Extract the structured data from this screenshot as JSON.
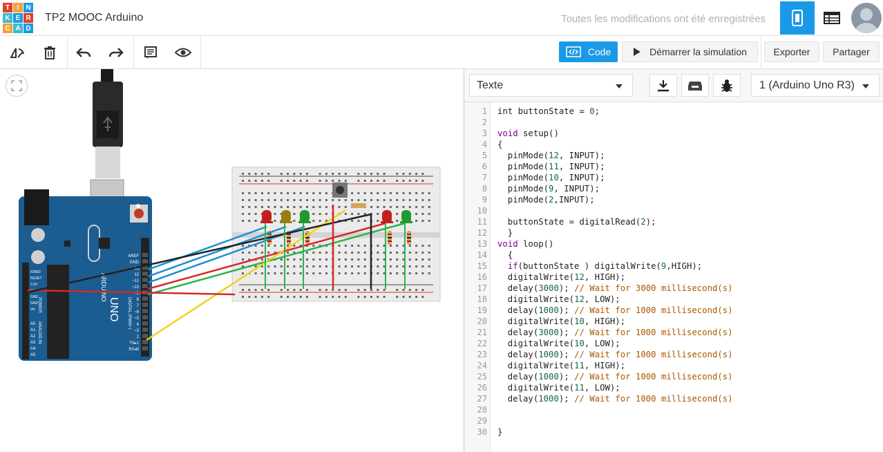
{
  "app": {
    "logo_letters": [
      "T",
      "I",
      "N",
      "K",
      "E",
      "R",
      "C",
      "A",
      "D"
    ],
    "logo_colors": [
      "#e2412a",
      "#f2a33a",
      "#1a9ae6",
      "#3dbbd1",
      "#1a9ae6",
      "#e2412a",
      "#f2a33a",
      "#3dbbd1",
      "#1a9ae6"
    ],
    "project_title": "TP2 MOOC Arduino",
    "save_status": "Toutes les modifications ont été enregistrées",
    "accent_color": "#1a9ae6"
  },
  "toolbar": {
    "icons": [
      "rotate-icon",
      "trash-icon",
      "undo-icon",
      "redo-icon",
      "notes-icon",
      "eye-icon"
    ],
    "code_label": "Code",
    "simulate_label": "Démarrer la simulation",
    "export_label": "Exporter",
    "share_label": "Partager"
  },
  "code_panel": {
    "mode": "Texte",
    "board": "1 (Arduino Uno R3)",
    "buttons": [
      "download-icon",
      "library-icon",
      "debugger-icon"
    ]
  },
  "circuit": {
    "arduino_label": "UNO",
    "arduino_brand": "ARDUINO",
    "digital_label": "DIGITAL (PWM~)",
    "analog_label": "ANALOG IN",
    "power_label": "POWER",
    "digital_pins": [
      "AREF",
      "GND",
      "13",
      "12",
      "~11",
      "~10",
      "~9",
      "8",
      "7",
      "~6",
      "~5",
      "4",
      "~3",
      "2",
      "TX▸1",
      "RX◂0"
    ],
    "power_pins": [
      "IOREF",
      "RESET",
      "3.3V",
      "5V",
      "GND",
      "GND",
      "Vin"
    ],
    "analog_pins": [
      "A0",
      "A1",
      "A2",
      "A3",
      "A4",
      "A5"
    ],
    "leds": [
      {
        "color": "#c41e1e"
      },
      {
        "color": "#9a7d12"
      },
      {
        "color": "#1f9a2c"
      },
      {
        "color": "#c41e1e"
      },
      {
        "color": "#1f9a2c"
      }
    ],
    "wires": [
      {
        "color": "#1b8fd1",
        "from": "13",
        "to": "led-1"
      },
      {
        "color": "#1b8fd1",
        "from": "12",
        "to": "led-2"
      },
      {
        "color": "#1b8fd1",
        "from": "11",
        "to": "led-3"
      },
      {
        "color": "#d62828",
        "from": "10",
        "to": "led-4"
      },
      {
        "color": "#2bb24c",
        "from": "9",
        "to": "led-5"
      },
      {
        "color": "#f2d21a",
        "from": "2",
        "to": "button"
      },
      {
        "color": "#d62828",
        "from": "5V",
        "to": "rail"
      },
      {
        "color": "#222222",
        "from": "GND",
        "to": "rail"
      }
    ]
  },
  "code": {
    "lines": [
      [
        [
          "int buttonState = ",
          ""
        ],
        [
          "0",
          "num"
        ],
        [
          ";",
          ""
        ]
      ],
      [],
      [
        [
          "void",
          "kw"
        ],
        [
          " setup()",
          ""
        ]
      ],
      [
        [
          "{",
          ""
        ]
      ],
      [
        [
          "  pinMode(",
          ""
        ],
        [
          "12",
          "num"
        ],
        [
          ", INPUT);",
          ""
        ]
      ],
      [
        [
          "  pinMode(",
          ""
        ],
        [
          "11",
          "num"
        ],
        [
          ", INPUT);",
          ""
        ]
      ],
      [
        [
          "  pinMode(",
          ""
        ],
        [
          "10",
          "num"
        ],
        [
          ", INPUT);",
          ""
        ]
      ],
      [
        [
          "  pinMode(",
          ""
        ],
        [
          "9",
          "num"
        ],
        [
          ", INPUT);",
          ""
        ]
      ],
      [
        [
          "  pinMode(",
          ""
        ],
        [
          "2",
          "num"
        ],
        [
          ",INPUT);",
          ""
        ]
      ],
      [],
      [
        [
          "  buttonState = digitalRead(",
          ""
        ],
        [
          "2",
          "num"
        ],
        [
          ");",
          ""
        ]
      ],
      [
        [
          "  }",
          ""
        ]
      ],
      [
        [
          "void",
          "kw"
        ],
        [
          " loop()",
          ""
        ]
      ],
      [
        [
          "  {",
          ""
        ]
      ],
      [
        [
          "  ",
          ""
        ],
        [
          "if",
          "kw"
        ],
        [
          "(buttonState ) digitalWrite(",
          ""
        ],
        [
          "9",
          "num"
        ],
        [
          ",HIGH);",
          ""
        ]
      ],
      [
        [
          "  digitalWrite(",
          ""
        ],
        [
          "12",
          "num"
        ],
        [
          ", HIGH);",
          ""
        ]
      ],
      [
        [
          "  delay(",
          ""
        ],
        [
          "3000",
          "num"
        ],
        [
          "); ",
          ""
        ],
        [
          "// Wait for 3000 millisecond(s)",
          "cm"
        ]
      ],
      [
        [
          "  digitalWrite(",
          ""
        ],
        [
          "12",
          "num"
        ],
        [
          ", LOW);",
          ""
        ]
      ],
      [
        [
          "  delay(",
          ""
        ],
        [
          "1000",
          "num"
        ],
        [
          "); ",
          ""
        ],
        [
          "// Wait for 1000 millisecond(s)",
          "cm"
        ]
      ],
      [
        [
          "  digitalWrite(",
          ""
        ],
        [
          "10",
          "num"
        ],
        [
          ", HIGH);",
          ""
        ]
      ],
      [
        [
          "  delay(",
          ""
        ],
        [
          "3000",
          "num"
        ],
        [
          "); ",
          ""
        ],
        [
          "// Wait for 1000 millisecond(s)",
          "cm"
        ]
      ],
      [
        [
          "  digitalWrite(",
          ""
        ],
        [
          "10",
          "num"
        ],
        [
          ", LOW);",
          ""
        ]
      ],
      [
        [
          "  delay(",
          ""
        ],
        [
          "1000",
          "num"
        ],
        [
          "); ",
          ""
        ],
        [
          "// Wait for 1000 millisecond(s)",
          "cm"
        ]
      ],
      [
        [
          "  digitalWrite(",
          ""
        ],
        [
          "11",
          "num"
        ],
        [
          ", HIGH);",
          ""
        ]
      ],
      [
        [
          "  delay(",
          ""
        ],
        [
          "1000",
          "num"
        ],
        [
          "); ",
          ""
        ],
        [
          "// Wait for 1000 millisecond(s)",
          "cm"
        ]
      ],
      [
        [
          "  digitalWrite(",
          ""
        ],
        [
          "11",
          "num"
        ],
        [
          ", LOW);",
          ""
        ]
      ],
      [
        [
          "  delay(",
          ""
        ],
        [
          "1000",
          "num"
        ],
        [
          "); ",
          ""
        ],
        [
          "// Wait for 1000 millisecond(s)",
          "cm"
        ]
      ],
      [],
      [],
      [
        [
          "}",
          ""
        ]
      ]
    ]
  }
}
